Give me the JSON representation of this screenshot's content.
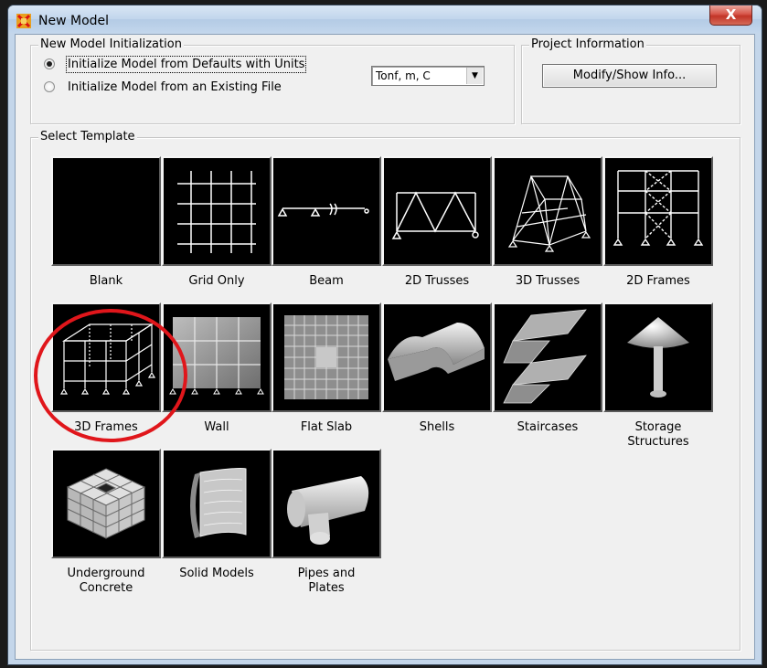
{
  "window": {
    "title": "New Model",
    "close_label": "X"
  },
  "init_group": {
    "title": "New Model Initialization",
    "options": [
      {
        "label": "Initialize Model from Defaults with Units",
        "checked": true
      },
      {
        "label": "Initialize Model  from an Existing File",
        "checked": false
      }
    ],
    "units": {
      "selected": "Tonf, m, C"
    }
  },
  "project_group": {
    "title": "Project Information",
    "button_label": "Modify/Show Info..."
  },
  "template_group": {
    "title": "Select Template",
    "templates": [
      {
        "label": "Blank",
        "icon": "blank-icon"
      },
      {
        "label": "Grid Only",
        "icon": "grid-icon"
      },
      {
        "label": "Beam",
        "icon": "beam-icon"
      },
      {
        "label": "2D Trusses",
        "icon": "truss-2d-icon"
      },
      {
        "label": "3D Trusses",
        "icon": "truss-3d-icon"
      },
      {
        "label": "2D Frames",
        "icon": "frame-2d-icon"
      },
      {
        "label": "3D Frames",
        "icon": "frame-3d-icon"
      },
      {
        "label": "Wall",
        "icon": "wall-icon"
      },
      {
        "label": "Flat Slab",
        "icon": "flat-slab-icon"
      },
      {
        "label": "Shells",
        "icon": "shells-icon"
      },
      {
        "label": "Staircases",
        "icon": "staircase-icon"
      },
      {
        "label": "Storage\nStructures",
        "icon": "storage-icon"
      },
      {
        "label": "Underground\nConcrete",
        "icon": "underground-icon"
      },
      {
        "label": "Solid Models",
        "icon": "solid-icon"
      },
      {
        "label": "Pipes and\nPlates",
        "icon": "pipes-icon"
      }
    ]
  },
  "annotation": {
    "highlighted_template": "3D Frames",
    "color": "#e0161b"
  }
}
